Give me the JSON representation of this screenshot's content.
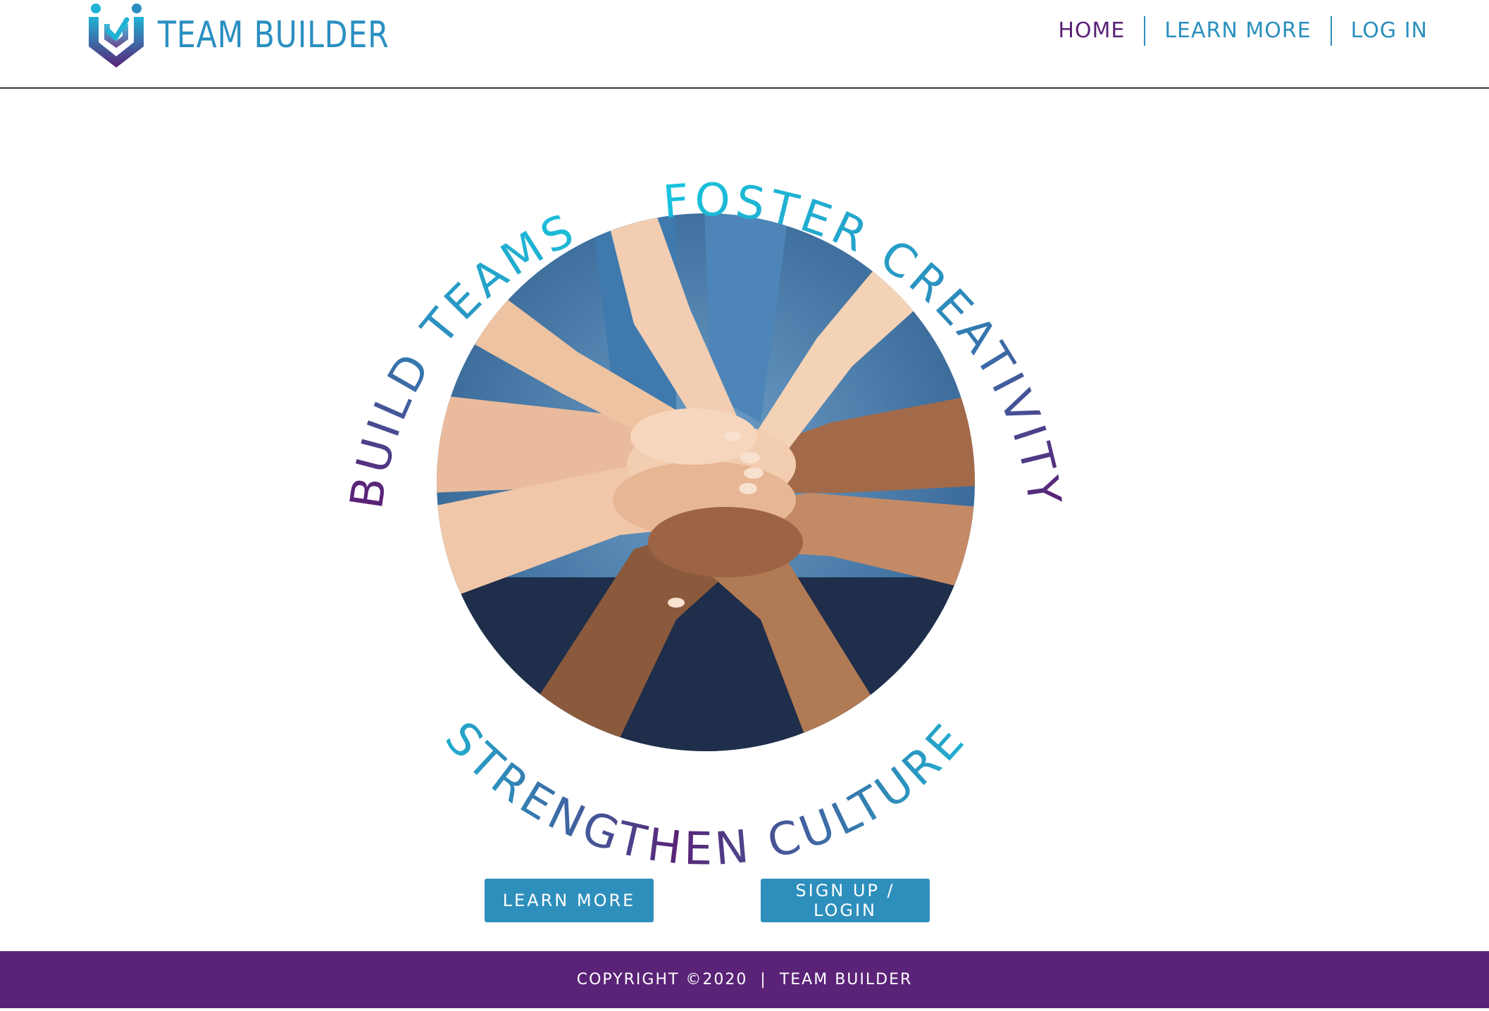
{
  "brand": {
    "name": "TEAM BUILDER",
    "logo_icon": "team-builder-shield-logo"
  },
  "nav": {
    "items": [
      {
        "label": "HOME",
        "active": true
      },
      {
        "label": "LEARN MORE",
        "active": false
      },
      {
        "label": "LOG IN",
        "active": false
      }
    ]
  },
  "hero": {
    "arc_text_left": "BUILD TEAMS",
    "arc_text_right": "FOSTER CREATIVITY",
    "arc_text_bottom": "STRENGTHEN CULTURE",
    "image": "hands-stacked-together-photo"
  },
  "actions": {
    "learn_more": "LEARN MORE",
    "signup_login": "SIGN UP / LOGIN"
  },
  "footer": {
    "copyright": "COPYRIGHT ©2020",
    "separator": "|",
    "brand": "TEAM BUILDER"
  },
  "colors": {
    "teal": "#17c2db",
    "blue": "#2b8fbe",
    "purple": "#5a2377",
    "footer_bg": "#5a2377",
    "button_bg": "#2e8fbd"
  }
}
